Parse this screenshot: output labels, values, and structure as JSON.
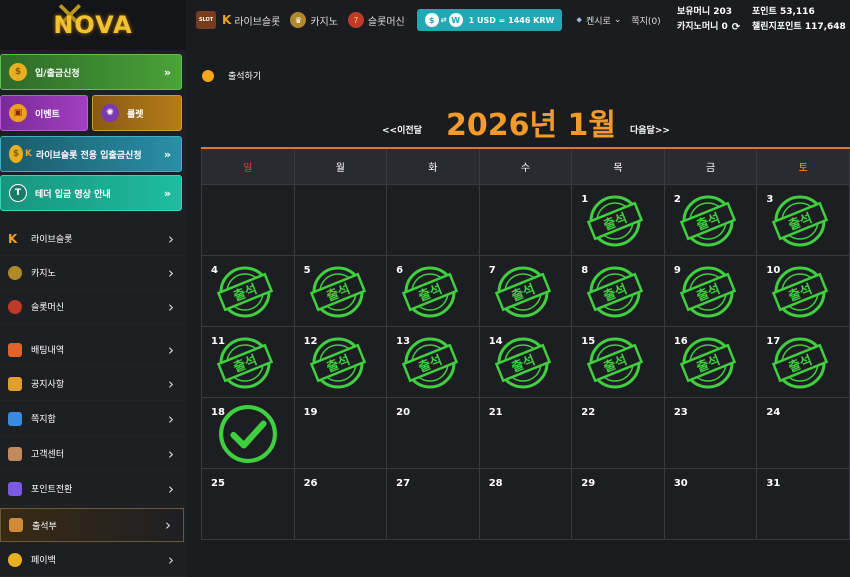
{
  "logo": {
    "text": "NOVA"
  },
  "topnav": {
    "items": [
      {
        "label": "라이브슬롯",
        "icon": "k-icon"
      },
      {
        "label": "카지노",
        "icon": "crown-icon"
      },
      {
        "label": "슬롯머신",
        "icon": "slot-icon"
      }
    ],
    "rate": "1 USD = 1446 KRW",
    "rate_coin_a": "$",
    "rate_coin_b": "W",
    "user": "켄시로",
    "message": "쪽지(0)",
    "hold_money": "보유머니 203",
    "casino_money": "카지노머니 0",
    "point": "포인트 53,116",
    "challenge_point": "챌린지포인트 117,648",
    "slot_badge": "SLOT"
  },
  "sidebar": {
    "btn_deposit": "입/출금신청",
    "btn_event": "이벤트",
    "btn_roulette": "룰렛",
    "btn_live_slot": "라이브슬롯 전용 입출금신청",
    "btn_tether": "테더 입금 영상 안내",
    "menu": [
      {
        "label": "라이브슬롯",
        "name": "sidebar-item-live-slot"
      },
      {
        "label": "카지노",
        "name": "sidebar-item-casino"
      },
      {
        "label": "슬롯머신",
        "name": "sidebar-item-slot-machine"
      },
      {
        "label": "배팅내역",
        "name": "sidebar-item-bet-history"
      },
      {
        "label": "공지사항",
        "name": "sidebar-item-notice"
      },
      {
        "label": "쪽지함",
        "name": "sidebar-item-messages"
      },
      {
        "label": "고객센터",
        "name": "sidebar-item-support"
      },
      {
        "label": "포인트전환",
        "name": "sidebar-item-point-convert"
      },
      {
        "label": "출석부",
        "name": "sidebar-item-attendance"
      },
      {
        "label": "페이백",
        "name": "sidebar-item-payback"
      }
    ]
  },
  "main": {
    "title": "출석하기",
    "prev": "<<이전달",
    "next": "다음달>>",
    "month": "2026년 1월",
    "weekdays": [
      "일",
      "월",
      "화",
      "수",
      "목",
      "금",
      "토"
    ],
    "stamp_text": "출석",
    "weeks": [
      [
        "",
        "",
        "",
        "",
        "1",
        "2",
        "3"
      ],
      [
        "4",
        "5",
        "6",
        "7",
        "8",
        "9",
        "10"
      ],
      [
        "11",
        "12",
        "13",
        "14",
        "15",
        "16",
        "17"
      ],
      [
        "18",
        "19",
        "20",
        "21",
        "22",
        "23",
        "24"
      ],
      [
        "25",
        "26",
        "27",
        "28",
        "29",
        "30",
        "31"
      ]
    ],
    "attended": [
      "1",
      "2",
      "3",
      "4",
      "5",
      "6",
      "7",
      "8",
      "9",
      "10",
      "11",
      "12",
      "13",
      "14",
      "15",
      "16",
      "17"
    ],
    "today": "18"
  },
  "colors": {
    "accent": "#f29a2a",
    "stamp": "#3fcf3f",
    "teal": "#22a8b4",
    "sunday": "#e84040",
    "saturday": "#f29a2a"
  }
}
